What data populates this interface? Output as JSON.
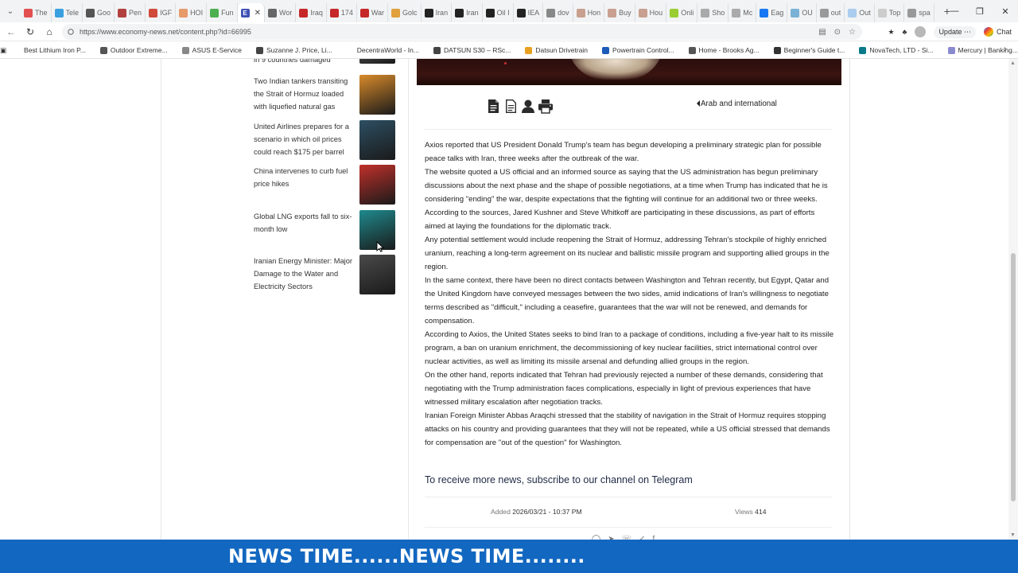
{
  "browser": {
    "tabs": [
      {
        "label": "The",
        "icon": "z-icon",
        "color": "#e25050"
      },
      {
        "label": "Tele",
        "icon": "globe-icon",
        "color": "#3aa0e0"
      },
      {
        "label": "Goo",
        "icon": "finance-icon",
        "color": "#555555"
      },
      {
        "label": "Pen",
        "icon": "shield-icon",
        "color": "#b0413e"
      },
      {
        "label": "IGF",
        "icon": "pdf-icon",
        "color": "#d04b3a"
      },
      {
        "label": "HOI",
        "icon": "image-icon",
        "color": "#e79a6a"
      },
      {
        "label": "Fun",
        "icon": "frog-icon",
        "color": "#4caf50"
      },
      {
        "label": "",
        "icon": "economy-icon",
        "color": "#3f51b5",
        "active": true
      },
      {
        "label": "Wor",
        "icon": "globe-icon",
        "color": "#666666"
      },
      {
        "label": "Iraq",
        "icon": "flag-icon",
        "color": "#c62828"
      },
      {
        "label": "174",
        "icon": "flag-icon",
        "color": "#c62828"
      },
      {
        "label": "War",
        "icon": "flag-icon",
        "color": "#c62828"
      },
      {
        "label": "Golc",
        "icon": "globe-icon",
        "color": "#e0a03c"
      },
      {
        "label": "Iran",
        "icon": "circle-icon",
        "color": "#222222"
      },
      {
        "label": "Iran",
        "icon": "circle-icon",
        "color": "#222222"
      },
      {
        "label": "Oil I",
        "icon": "circle-icon",
        "color": "#222222"
      },
      {
        "label": "IEA",
        "icon": "circle-icon",
        "color": "#222222"
      },
      {
        "label": "dov",
        "icon": "search-icon",
        "color": "#888888"
      },
      {
        "label": "Hon",
        "icon": "image-icon",
        "color": "#c9a090"
      },
      {
        "label": "Buy",
        "icon": "tag-icon",
        "color": "#c9a090"
      },
      {
        "label": "Hou",
        "icon": "tag-icon",
        "color": "#c9a090"
      },
      {
        "label": "Onli",
        "icon": "d-icon",
        "color": "#9acd32"
      },
      {
        "label": "Sho",
        "icon": "globe-icon",
        "color": "#aaaaaa"
      },
      {
        "label": "Mc",
        "icon": "chart-icon",
        "color": "#aaaaaa"
      },
      {
        "label": "Eag",
        "icon": "facebook-icon",
        "color": "#1877f2"
      },
      {
        "label": "OU",
        "icon": "check-icon",
        "color": "#7ab2d6"
      },
      {
        "label": "out",
        "icon": "search-icon",
        "color": "#999999"
      },
      {
        "label": "Out",
        "icon": "image-icon",
        "color": "#aaccee"
      },
      {
        "label": "Top",
        "icon": "image-icon",
        "color": "#cccccc"
      },
      {
        "label": "spa",
        "icon": "search-icon",
        "color": "#999999"
      }
    ],
    "url": "https://www.economy-news.net/content.php?id=66995",
    "update_label": "Update",
    "chat_label": "Chat",
    "bookmarks": [
      {
        "label": "Best Lithium Iron P...",
        "color": "#ffffff"
      },
      {
        "label": "Outdoor Extreme...",
        "color": "#555555"
      },
      {
        "label": "ASUS E-Service",
        "color": "#888888"
      },
      {
        "label": "Suzanne J. Price, Li...",
        "color": "#444444"
      },
      {
        "label": "DecentraWorld - In...",
        "color": "#ffffff"
      },
      {
        "label": "DATSUN S30 – RSc...",
        "color": "#444444"
      },
      {
        "label": "Datsun Drivetrain",
        "color": "#e8a020"
      },
      {
        "label": "Powertrain Control...",
        "color": "#1e5bb8"
      },
      {
        "label": "Home - Brooks Ag...",
        "color": "#555555"
      },
      {
        "label": "Beginner's Guide t...",
        "color": "#333333"
      },
      {
        "label": "NovaTech, LTD - Si...",
        "color": "#0a7a8a"
      },
      {
        "label": "Mercury | Banking...",
        "color": "#8a8ad0"
      }
    ]
  },
  "related": [
    {
      "title": "in 9 countries damaged",
      "thumb": "#6a6a6a"
    },
    {
      "title": "Two Indian tankers transiting the Strait of Hormuz loaded with liquefied natural gas",
      "thumb": "#d88a2a"
    },
    {
      "title": "United Airlines prepares for a scenario in which oil prices could reach $175 per barrel",
      "thumb": "#2d4f63"
    },
    {
      "title": "China intervenes to curb fuel price hikes",
      "thumb": "#c0302a"
    },
    {
      "title": "Global LNG exports fall to six-month low",
      "thumb": "#1f8a8e"
    },
    {
      "title": "Iranian Energy Minister: Major Damage to the Water and Electricity Sectors",
      "thumb": "#4a4a4a"
    }
  ],
  "article": {
    "category": "Arab and international",
    "paragraphs": [
      "Axios reported that US President Donald Trump's team has begun developing a preliminary strategic plan for possible peace talks with Iran, three weeks after the outbreak of the war.",
      "The website quoted a US official and an informed source as saying that the US administration has begun preliminary discussions about the next phase and the shape of possible negotiations, at a time when Trump has indicated that he is considering \"ending\" the war, despite expectations that the fighting will continue for an additional two or three weeks.",
      "According to the sources, Jared Kushner and Steve Whitkoff are participating in these discussions, as part of efforts aimed at laying the foundations for the diplomatic track.",
      "Any potential settlement would include reopening the Strait of Hormuz, addressing Tehran's stockpile of highly enriched uranium, reaching a long-term agreement on its nuclear and ballistic missile program and supporting allied groups in the region.",
      "In the same context, there have been no direct contacts between Washington and Tehran recently, but Egypt, Qatar and the United Kingdom have conveyed messages between the two sides, amid indications of Iran's willingness to negotiate terms described as \"difficult,\" including a ceasefire, guarantees that the war will not be renewed, and demands for compensation.",
      "According to Axios, the United States seeks to bind Iran to a package of conditions, including a five-year halt to its missile program, a ban on uranium enrichment, the decommissioning of key nuclear facilities, strict international control over nuclear activities, as well as limiting its missile arsenal and defunding allied groups in the region.",
      "On the other hand, reports indicated that Tehran had previously rejected a number of these demands, considering that negotiating with the Trump administration faces complications, especially in light of previous experiences that have witnessed military escalation after negotiation tracks.",
      "Iranian Foreign Minister Abbas Araqchi stressed that the stability of navigation in the Strait of Hormuz requires stopping attacks on his country and providing guarantees that they will not be repeated, while a US official stressed that demands for compensation are \"out of the question\" for Washington."
    ],
    "telegram_cta": "To receive more news, subscribe to our channel on Telegram",
    "added_label": "Added",
    "added_value": "2026/03/21 - 10:37 PM",
    "views_label": "Views",
    "views_value": "414"
  },
  "ticker": {
    "text": "NEWS TIME......NEWS TIME........",
    "background": "#1267c0"
  }
}
